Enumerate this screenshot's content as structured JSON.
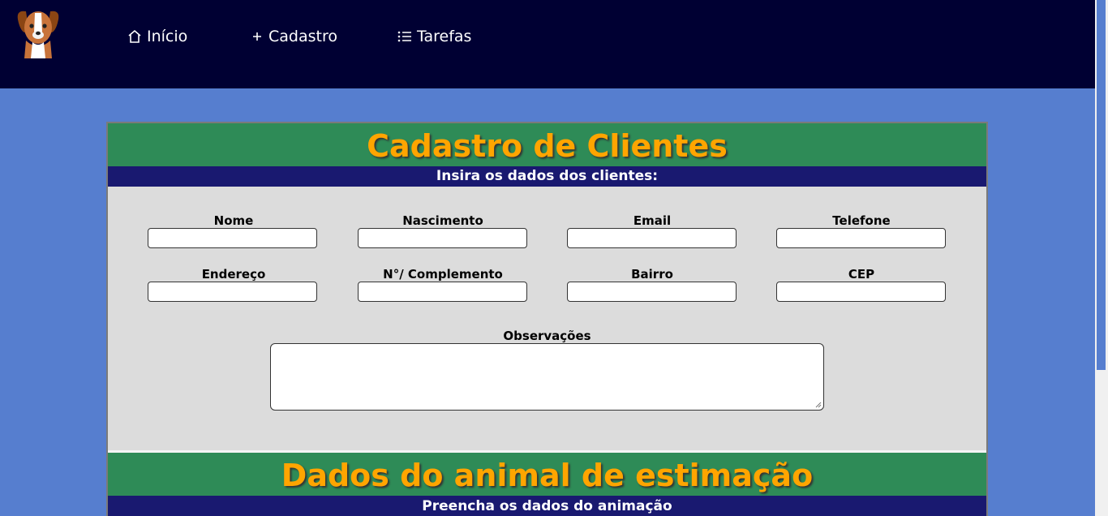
{
  "nav": {
    "logo_icon": "dog-icon",
    "items": [
      {
        "label": "Início",
        "icon": "home-icon"
      },
      {
        "label": "Cadastro",
        "icon": "plus-icon"
      },
      {
        "label": "Tarefas",
        "icon": "list-icon"
      }
    ]
  },
  "clients": {
    "title": "Cadastro de Clientes",
    "subtitle": "Insira os dados dos clientes:",
    "fields": [
      {
        "label": "Nome",
        "value": ""
      },
      {
        "label": "Nascimento",
        "value": ""
      },
      {
        "label": "Email",
        "value": ""
      },
      {
        "label": "Telefone",
        "value": ""
      },
      {
        "label": "Endereço",
        "value": ""
      },
      {
        "label": "N°/ Complemento",
        "value": ""
      },
      {
        "label": "Bairro",
        "value": ""
      },
      {
        "label": "CEP",
        "value": ""
      }
    ],
    "notes": {
      "label": "Observações",
      "value": ""
    }
  },
  "pet": {
    "title": "Dados do animal de estimação",
    "subtitle": "Preencha os dados do animação"
  },
  "colors": {
    "navbar": "#000033",
    "background": "#567ecf",
    "section_header": "#2e8b57",
    "title_text": "#ffa500",
    "subheader": "#191970",
    "form_body": "#dcdcdc"
  }
}
